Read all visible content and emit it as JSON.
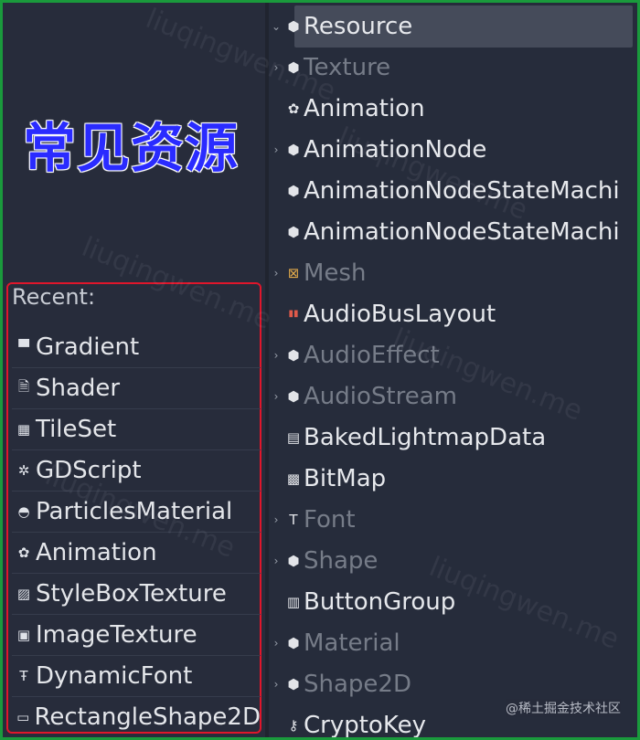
{
  "heading": "常见资源",
  "recent": {
    "label": "Recent:",
    "items": [
      {
        "label": "Gradient",
        "icon": "gradient-icon",
        "glyph": "▀"
      },
      {
        "label": "Shader",
        "icon": "shader-icon",
        "glyph": "🗎"
      },
      {
        "label": "TileSet",
        "icon": "tileset-icon",
        "glyph": "▦"
      },
      {
        "label": "GDScript",
        "icon": "gear-icon",
        "glyph": "✲"
      },
      {
        "label": "ParticlesMaterial",
        "icon": "particles-icon",
        "glyph": "◓"
      },
      {
        "label": "Animation",
        "icon": "film-reel-icon",
        "glyph": "✿"
      },
      {
        "label": "StyleBoxTexture",
        "icon": "stylebox-icon",
        "glyph": "▨"
      },
      {
        "label": "ImageTexture",
        "icon": "image-icon",
        "glyph": "▣"
      },
      {
        "label": "DynamicFont",
        "icon": "font-icon",
        "glyph": "Ŧ"
      },
      {
        "label": "RectangleShape2D",
        "icon": "rectangle-icon",
        "glyph": "▭"
      }
    ]
  },
  "tree": {
    "items": [
      {
        "label": "Resource",
        "icon": "cube-icon",
        "glyph": "⬢",
        "arrow": "⌄",
        "dim": false,
        "selected": true
      },
      {
        "label": "Texture",
        "icon": "cube-icon",
        "glyph": "⬢",
        "arrow": "›",
        "dim": true
      },
      {
        "label": "Animation",
        "icon": "film-reel-icon",
        "glyph": "✿",
        "arrow": "",
        "dim": false
      },
      {
        "label": "AnimationNode",
        "icon": "cube-icon",
        "glyph": "⬢",
        "arrow": "›",
        "dim": false
      },
      {
        "label": "AnimationNodeStateMachi",
        "icon": "cube-icon",
        "glyph": "⬢",
        "arrow": "",
        "dim": false
      },
      {
        "label": "AnimationNodeStateMachi",
        "icon": "cube-icon",
        "glyph": "⬢",
        "arrow": "",
        "dim": false
      },
      {
        "label": "Mesh",
        "icon": "mesh-icon",
        "glyph": "⊠",
        "arrow": "›",
        "dim": true
      },
      {
        "label": "AudioBusLayout",
        "icon": "audio-bus-icon",
        "glyph": "▮▮",
        "arrow": "",
        "dim": false
      },
      {
        "label": "AudioEffect",
        "icon": "cube-icon",
        "glyph": "⬢",
        "arrow": "›",
        "dim": true
      },
      {
        "label": "AudioStream",
        "icon": "cube-icon",
        "glyph": "⬢",
        "arrow": "›",
        "dim": true
      },
      {
        "label": "BakedLightmapData",
        "icon": "lightmap-icon",
        "glyph": "▤",
        "arrow": "",
        "dim": false
      },
      {
        "label": "BitMap",
        "icon": "bitmap-icon",
        "glyph": "▩",
        "arrow": "",
        "dim": false
      },
      {
        "label": "Font",
        "icon": "font-icon",
        "glyph": "T",
        "arrow": "›",
        "dim": true
      },
      {
        "label": "Shape",
        "icon": "cube-icon",
        "glyph": "⬢",
        "arrow": "›",
        "dim": true
      },
      {
        "label": "ButtonGroup",
        "icon": "button-group-icon",
        "glyph": "▥",
        "arrow": "",
        "dim": false
      },
      {
        "label": "Material",
        "icon": "cube-icon",
        "glyph": "⬢",
        "arrow": "›",
        "dim": true
      },
      {
        "label": "Shape2D",
        "icon": "cube-icon",
        "glyph": "⬢",
        "arrow": "›",
        "dim": true
      },
      {
        "label": "CryptoKey",
        "icon": "key-icon",
        "glyph": "⚷",
        "arrow": "",
        "dim": false
      }
    ]
  },
  "watermark": "liuqingwen.me",
  "credit": "@稀土掘金技术社区",
  "colors": {
    "frame": "#1a9a3c",
    "recent_border": "#e0162b",
    "heading": "#2a2bff",
    "background": "#262c3b"
  }
}
